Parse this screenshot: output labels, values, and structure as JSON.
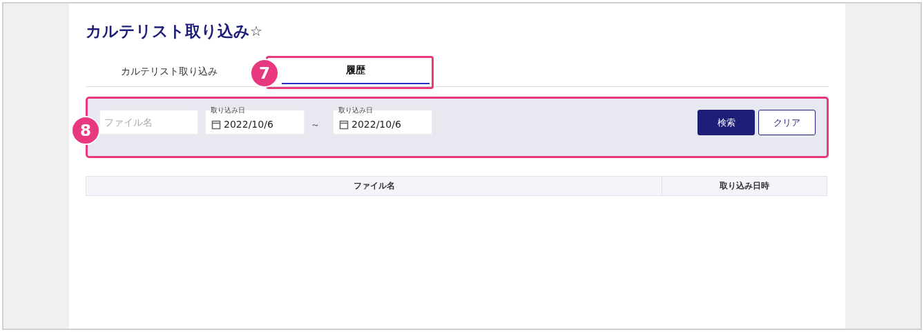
{
  "title": "カルテリスト取り込み",
  "favorite": {
    "icon": "☆",
    "on": false
  },
  "tabs": [
    {
      "label": "カルテリスト取り込み",
      "selected": false
    },
    {
      "label": "履歴",
      "selected": true
    }
  ],
  "filter": {
    "file_name": {
      "placeholder": "ファイル名"
    },
    "date_from": {
      "label": "取り込み日",
      "value": "2022/10/6"
    },
    "separator": "～",
    "date_to": {
      "label": "取り込み日",
      "value": "2022/10/6"
    },
    "buttons": [
      {
        "label": "検索",
        "kind": "primary"
      },
      {
        "label": "クリア",
        "kind": "secondary"
      }
    ]
  },
  "table": {
    "columns": [
      "ファイル名",
      "取り込み日時"
    ]
  },
  "callouts": [
    {
      "label": "7"
    },
    {
      "label": "8"
    }
  ]
}
